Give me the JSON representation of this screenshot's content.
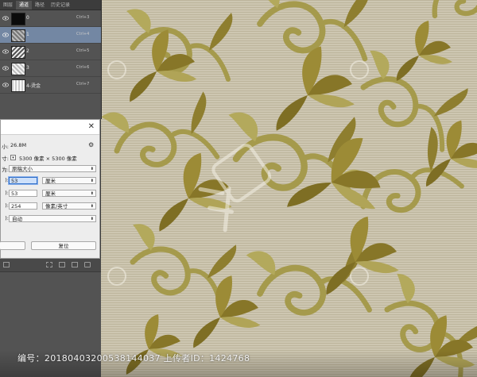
{
  "panel": {
    "tabs": [
      "图层",
      "通道",
      "路径",
      "历史记录"
    ],
    "active_tab": 1,
    "channels": [
      {
        "name": "0",
        "shortcut": "Ctrl+3",
        "thumb": "#0b0b0b",
        "selected": false
      },
      {
        "name": "1",
        "shortcut": "Ctrl+4",
        "thumb": "#8a8a8a",
        "selected": true
      },
      {
        "name": "2",
        "shortcut": "Ctrl+5",
        "thumb": "#9a9a9a",
        "selected": false
      },
      {
        "name": "3",
        "shortcut": "Ctrl+6",
        "thumb": "#c8c8c8",
        "selected": false
      },
      {
        "name": "4-烫金",
        "shortcut": "Ctrl+7",
        "thumb": "#dcdcdc",
        "selected": false
      }
    ]
  },
  "dialog": {
    "close": "✕",
    "size_label": "小:",
    "size_value": "26.8M",
    "dims_label": "寸:",
    "dims_value": "5300 像素 × 5300 像素",
    "fit_label": "为:",
    "fit_value": "原稿大小",
    "width_label": "):",
    "width_value": "53",
    "width_unit": "厘米",
    "height_label": "):",
    "height_value": "53",
    "height_unit": "厘米",
    "res_label": "):",
    "res_value": "254",
    "res_unit": "像素/英寸",
    "resample_label": "):",
    "resample_value": "自动",
    "reset_button": "复位"
  },
  "watermark": {
    "text": "编号：20180403200538144037 上传者ID：1424768"
  },
  "colors": {
    "canvas_bg": "#c9c2ad",
    "pattern_dark": "#8a7a2e",
    "pattern_light": "#b7ad63",
    "selected_channel": "#7387a3"
  }
}
